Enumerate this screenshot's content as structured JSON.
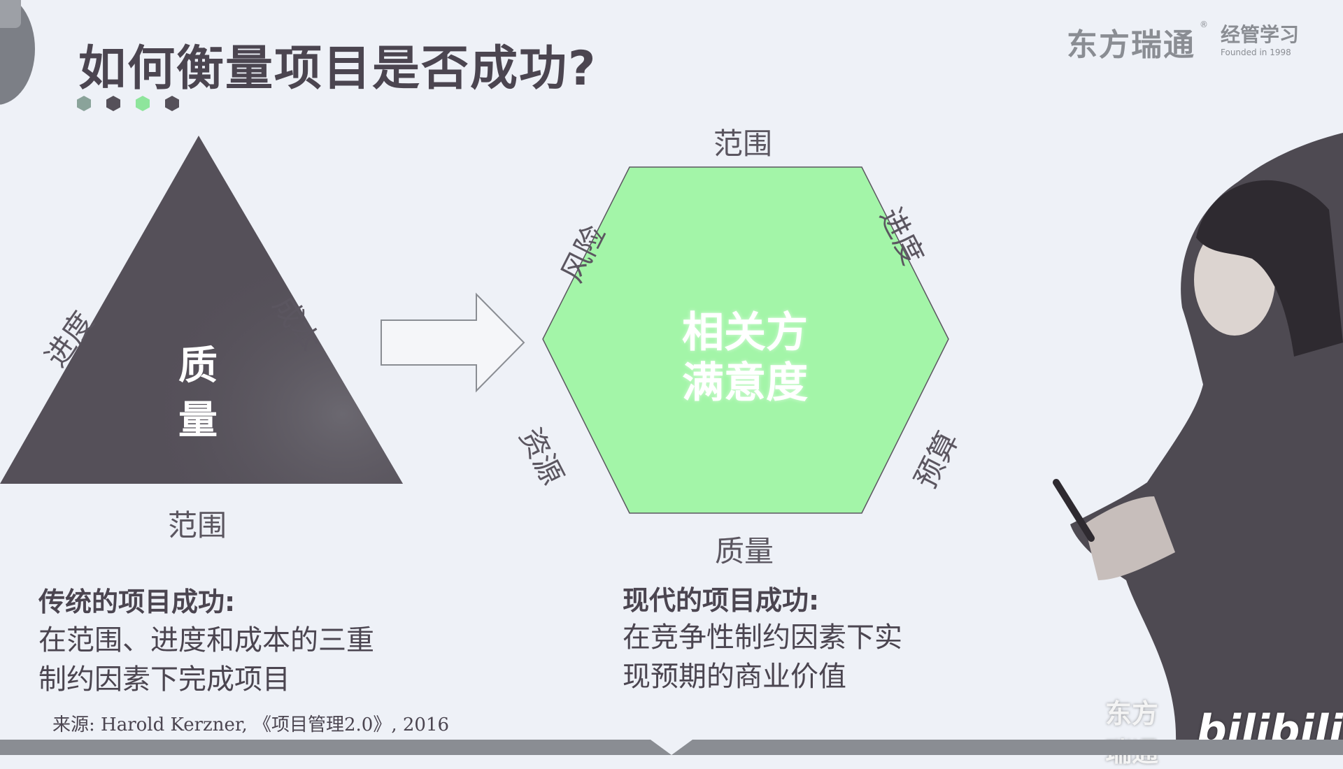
{
  "title": "如何衡量项目是否成功?",
  "dot_colors": [
    "#8aa39a",
    "#555059",
    "#8ee59c",
    "#555059"
  ],
  "logo": {
    "name": "东方瑞通",
    "reg": "®",
    "sub_name": "经管学习",
    "sub_small": "Founded in 1998"
  },
  "triangle": {
    "left_label": "进度",
    "right_label": "成本",
    "bottom_label": "范围",
    "center_top": "质",
    "center_bottom": "量",
    "color": "#555059"
  },
  "hexagon": {
    "top": "范围",
    "top_right": "进度",
    "bottom_right": "预算",
    "bottom": "质量",
    "bottom_left": "资源",
    "top_left": "风险",
    "center_line1": "相关方",
    "center_line2": "满意度",
    "color": "#a3f5a8"
  },
  "traditional": {
    "title": "传统的项目成功:",
    "line1": "在范围、进度和成本的三重",
    "line2": "制约因素下完成项目"
  },
  "modern": {
    "title": "现代的项目成功:",
    "line1": "在竞争性制约因素下实",
    "line2": "现预期的商业价值"
  },
  "source": "来源: Harold Kerzner, 《项目管理2.0》, 2016",
  "watermark": {
    "name": "东方瑞通",
    "platform": "bilibili"
  }
}
